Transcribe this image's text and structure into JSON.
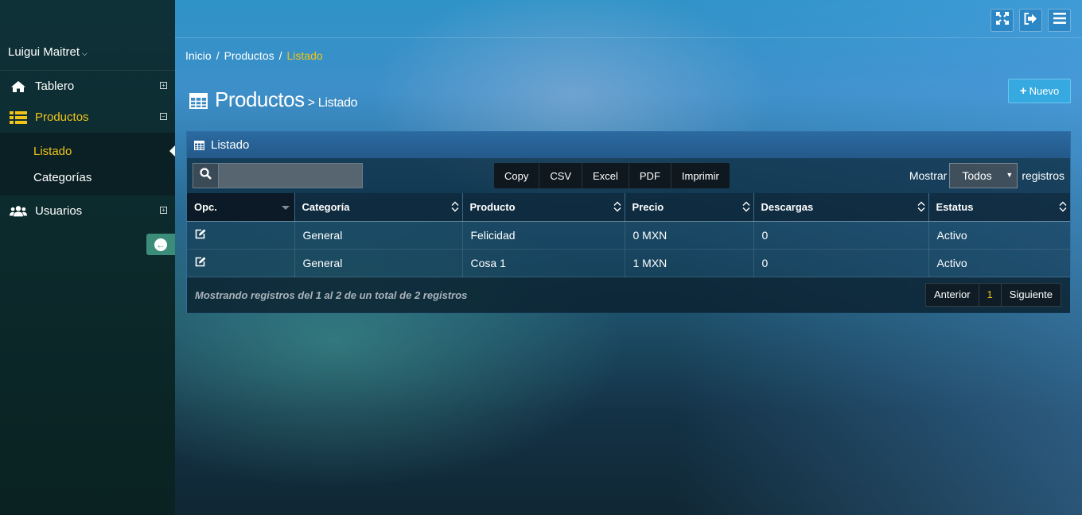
{
  "user": {
    "name": "Luigui Maitret"
  },
  "sidebar": {
    "items": [
      {
        "label": "Tablero",
        "icon": "home-icon",
        "toggle": "+"
      },
      {
        "label": "Productos",
        "icon": "list-icon",
        "toggle": "−",
        "active": true
      },
      {
        "label": "Usuarios",
        "icon": "users-icon",
        "toggle": "+"
      }
    ],
    "submenu": [
      {
        "label": "Listado",
        "active": true
      },
      {
        "label": "Categorías"
      }
    ],
    "collapse_icon": "arrow-left-circle-icon"
  },
  "topbar": {
    "buttons": [
      "fullscreen-icon",
      "logout-icon",
      "menu-icon"
    ]
  },
  "breadcrumb": {
    "home": "Inicio",
    "section": "Productos",
    "current": "Listado"
  },
  "page": {
    "title": "Productos",
    "subtitle": "> Listado",
    "new_button": "Nuevo"
  },
  "panel": {
    "title": "Listado",
    "export_buttons": [
      "Copy",
      "CSV",
      "Excel",
      "PDF",
      "Imprimir"
    ],
    "length": {
      "prefix": "Mostrar",
      "selected": "Todos",
      "suffix": "registros"
    },
    "columns": [
      "Opc.",
      "Categoría",
      "Producto",
      "Precio",
      "Descargas",
      "Estatus"
    ],
    "rows": [
      {
        "categoria": "General",
        "producto": "Felicidad",
        "precio": "0 MXN",
        "descargas": "0",
        "estatus": "Activo"
      },
      {
        "categoria": "General",
        "producto": "Cosa 1",
        "precio": "1 MXN",
        "descargas": "0",
        "estatus": "Activo"
      }
    ],
    "info": "Mostrando registros del 1 al 2 de un total de 2 registros",
    "pager": {
      "prev": "Anterior",
      "current": "1",
      "next": "Siguiente"
    }
  },
  "colors": {
    "accent": "#f0c419",
    "primary_button": "#36a9e1",
    "sidebar": "#0c2a2c"
  }
}
